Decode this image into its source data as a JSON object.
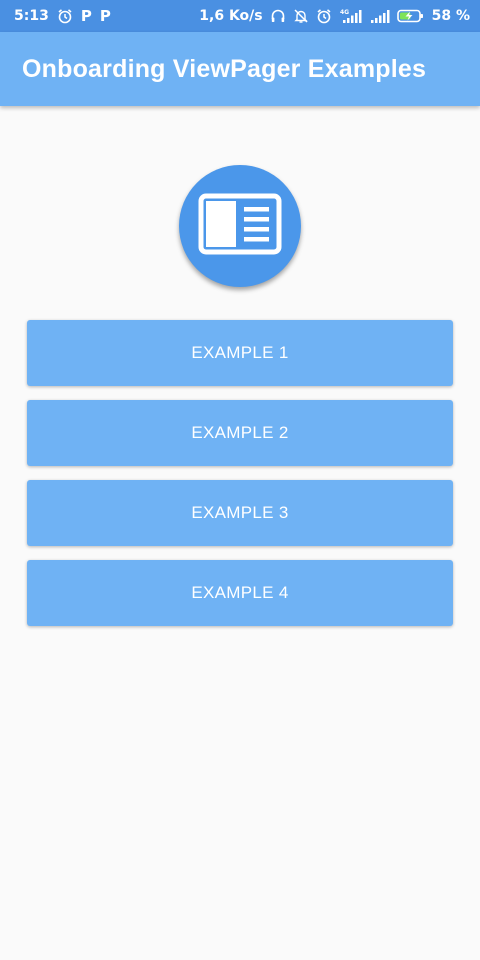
{
  "status_bar": {
    "time": "5:13",
    "left_icons": [
      "alarm-icon",
      "parking-p-icon",
      "parking-p-icon"
    ],
    "p_glyph": "P",
    "network_speed": "1,6 Ko/s",
    "right_icons": [
      "headphones-icon",
      "mute-bell-icon",
      "alarm-icon",
      "signal-4g-icon",
      "signal-icon",
      "battery-charging-icon"
    ],
    "network_type": "4G",
    "battery_percent": "58 %",
    "battery_level": 0.58,
    "background_color": "#4a90e2"
  },
  "app_bar": {
    "title": "Onboarding ViewPager Examples",
    "background_color": "#6fb2f4"
  },
  "logo": {
    "icon": "book-layout-icon",
    "background_color": "#4b97ea"
  },
  "buttons": [
    {
      "label": "EXAMPLE 1"
    },
    {
      "label": "EXAMPLE 2"
    },
    {
      "label": "EXAMPLE 3"
    },
    {
      "label": "EXAMPLE 4"
    }
  ],
  "colors": {
    "accent": "#6fb2f4",
    "page_background": "#fafafa",
    "text_on_accent": "#ffffff"
  }
}
